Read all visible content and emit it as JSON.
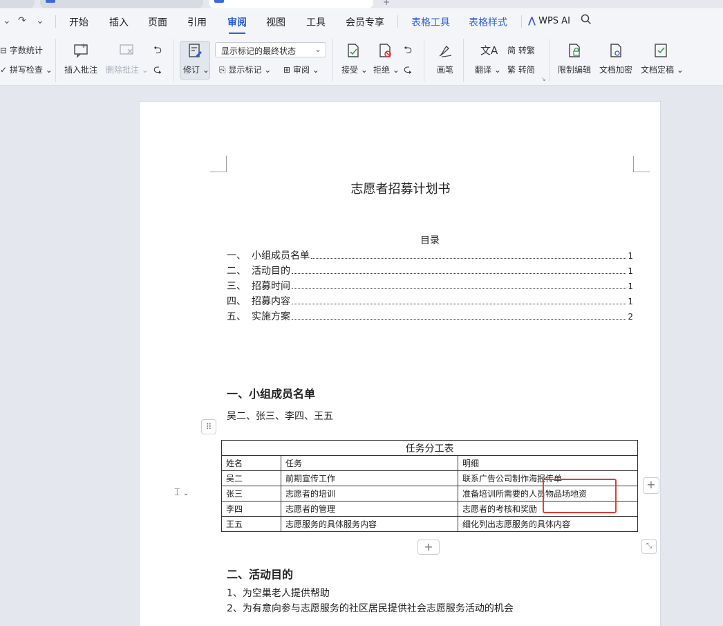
{
  "menu": {
    "items": [
      "开始",
      "插入",
      "页面",
      "引用",
      "审阅",
      "视图",
      "工具",
      "会员专享"
    ],
    "active": "审阅",
    "context_tabs": [
      "表格工具",
      "表格样式"
    ],
    "ai": "WPS AI"
  },
  "ribbon": {
    "word_count": "字数统计",
    "spell_check": "拼写检查",
    "insert_comment": "插入批注",
    "delete_comment": "删除批注",
    "track_changes": "修订",
    "display_mode": "显示标记的最终状态",
    "show_markup": "显示标记",
    "review": "审阅",
    "accept": "接受",
    "reject": "拒绝",
    "pen": "画笔",
    "translate": "翻译",
    "to_traditional": "转繁",
    "to_simplified": "转简",
    "restrict_edit": "限制编辑",
    "encrypt": "文档加密",
    "finalize": "文档定稿"
  },
  "document": {
    "title": "志愿者招募计划书",
    "toc_title": "目录",
    "toc": [
      {
        "num": "一、",
        "text": "小组成员名单",
        "page": "1"
      },
      {
        "num": "二、",
        "text": "活动目的",
        "page": "1"
      },
      {
        "num": "三、",
        "text": "招募时间",
        "page": "1"
      },
      {
        "num": "四、",
        "text": "招募内容",
        "page": "1"
      },
      {
        "num": "五、",
        "text": "实施方案",
        "page": "2"
      }
    ],
    "section1_heading": "一、小组成员名单",
    "members": "吴二、张三、李四、王五",
    "table": {
      "caption": "任务分工表",
      "headers": [
        "姓名",
        "任务",
        "明细"
      ],
      "rows": [
        [
          "吴二",
          "前期宣传工作",
          "联系广告公司制作海报传单"
        ],
        [
          "张三",
          "志愿者的培训",
          "准备培训所需要的人员物品场地资"
        ],
        [
          "李四",
          "志愿者的管理",
          "志愿者的考核和奖励"
        ],
        [
          "王五",
          "志愿服务的具体服务内容",
          "细化列出志愿服务的具体内容"
        ]
      ]
    },
    "section2_heading": "二、活动目的",
    "purpose": [
      "1、为空巢老人提供帮助",
      "2、为有意向参与志愿服务的社区居民提供社会志愿服务活动的机会"
    ]
  },
  "colors": {
    "accent": "#2b5fd9",
    "highlight_box": "#e53935"
  }
}
